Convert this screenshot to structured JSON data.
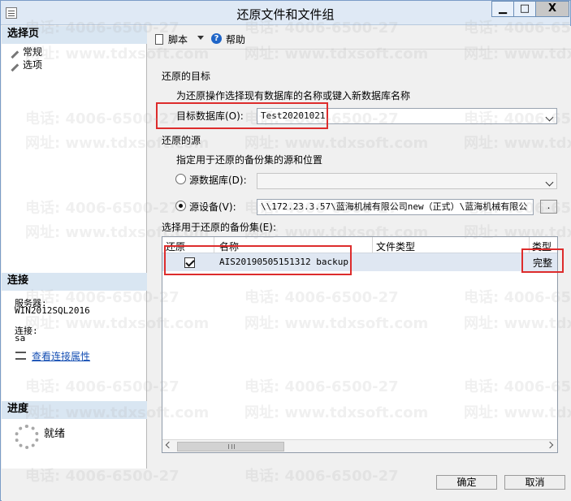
{
  "window": {
    "title": "还原文件和文件组",
    "minimize": "▁",
    "maximize": "□",
    "close": "X"
  },
  "left": {
    "select_page": "选择页",
    "pages": [
      "常规",
      "选项"
    ],
    "connection": "连接",
    "server_label": "服务器:",
    "server_value": "WIN2012SQL2016",
    "connection_label": "连接:",
    "connection_value": "sa",
    "view_connection": "查看连接属性",
    "progress": "进度",
    "progress_status": "就绪"
  },
  "toolbar": {
    "script": "脚本",
    "help": "帮助"
  },
  "restore": {
    "target_section": "还原的目标",
    "target_hint": "为还原操作选择现有数据库的名称或键入新数据库名称",
    "target_db_label": "目标数据库(O):",
    "target_db_value": "Test20201021",
    "source_section": "还原的源",
    "source_hint": "指定用于还原的备份集的源和位置",
    "source_db_label": "源数据库(D):",
    "source_device_label": "源设备(V):",
    "source_device_value": "\\\\172.23.3.57\\蓝海机械有限公司new（正式）\\蓝海机械有限公",
    "browse_label": ".",
    "backup_sets_label": "选择用于还原的备份集(E):"
  },
  "grid": {
    "headers": [
      "还原",
      "名称",
      "文件类型",
      "类型"
    ],
    "rows": [
      {
        "restore": true,
        "name": "AIS20190505151312 backup",
        "file_type": "",
        "type": "完整"
      }
    ]
  },
  "buttons": {
    "ok": "确定",
    "cancel": "取消"
  },
  "watermark": [
    "电话: 4006-6500-27",
    "网址: www.tdxsoft.com"
  ],
  "colors": {
    "accent": "#1f65c8",
    "highlight_box": "#dd2c2c"
  }
}
